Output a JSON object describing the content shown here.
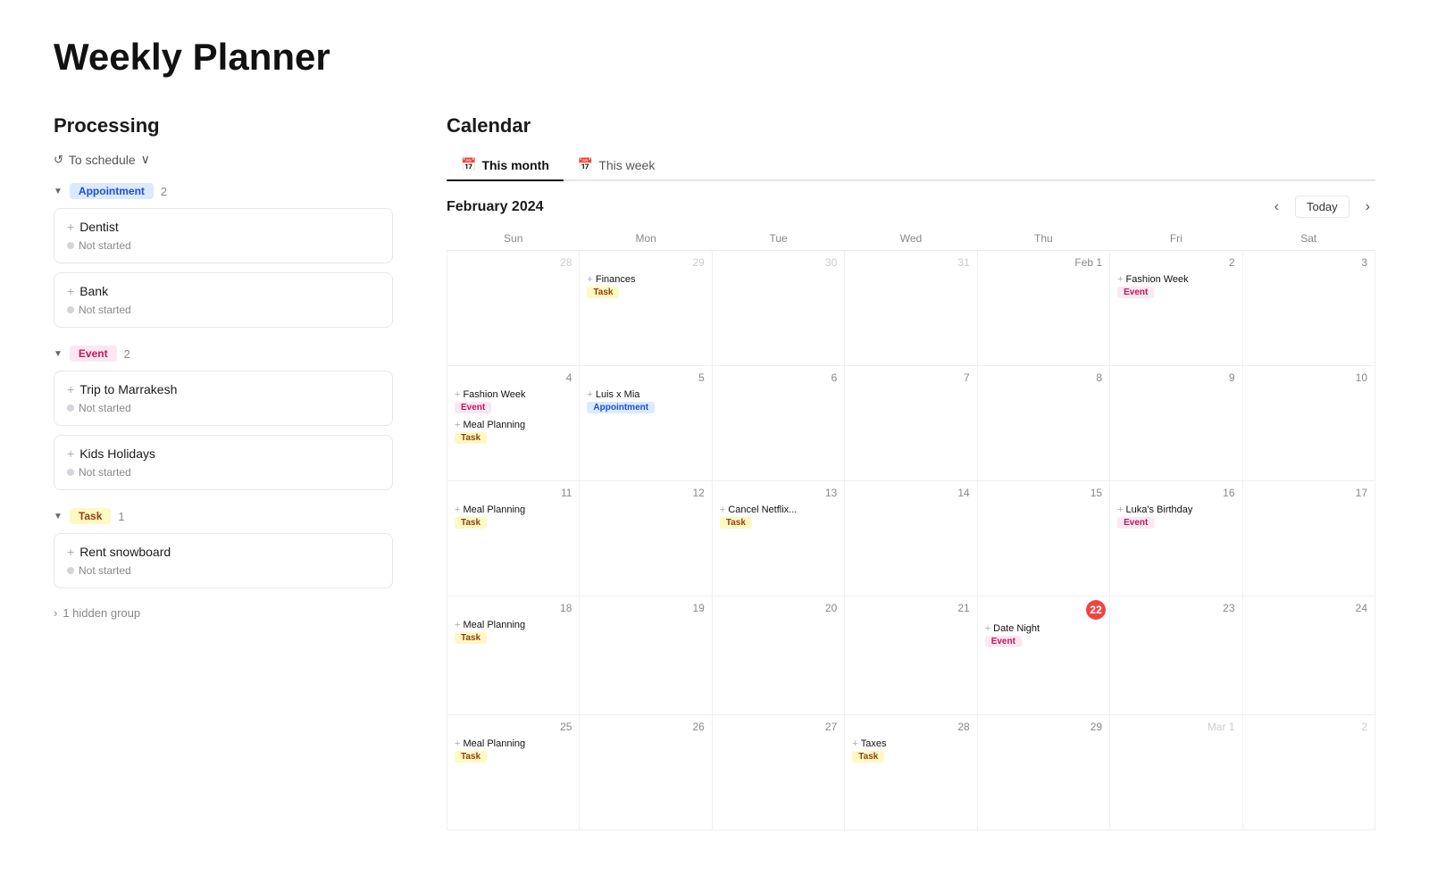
{
  "page": {
    "title": "Weekly Planner"
  },
  "left": {
    "section_title": "Processing",
    "schedule_label": "To schedule",
    "groups": [
      {
        "name": "appointment",
        "label": "Appointment",
        "badge_class": "badge-appointment",
        "count": 2,
        "tasks": [
          {
            "title": "Dentist",
            "status": "Not started"
          },
          {
            "title": "Bank",
            "status": "Not started"
          }
        ]
      },
      {
        "name": "event",
        "label": "Event",
        "badge_class": "badge-event",
        "count": 2,
        "tasks": [
          {
            "title": "Trip to Marrakesh",
            "status": "Not started"
          },
          {
            "title": "Kids Holidays",
            "status": "Not started"
          }
        ]
      },
      {
        "name": "task",
        "label": "Task",
        "badge_class": "badge-task",
        "count": 1,
        "tasks": [
          {
            "title": "Rent snowboard",
            "status": "Not started"
          }
        ]
      }
    ],
    "hidden_group_label": "1 hidden group"
  },
  "calendar": {
    "title": "Calendar",
    "tabs": [
      {
        "label": "This month",
        "active": true
      },
      {
        "label": "This week",
        "active": false
      }
    ],
    "month_label": "February 2024",
    "today_label": "Today",
    "day_headers": [
      "Sun",
      "Mon",
      "Tue",
      "Wed",
      "Thu",
      "Fri",
      "Sat"
    ],
    "weeks": [
      [
        {
          "num": "28",
          "other": true,
          "events": []
        },
        {
          "num": "29",
          "other": true,
          "events": [
            {
              "title": "Finances",
              "badge": "Task",
              "badge_class": "cal-badge-task"
            }
          ]
        },
        {
          "num": "30",
          "other": true,
          "events": []
        },
        {
          "num": "31",
          "other": true,
          "events": []
        },
        {
          "num": "Feb 1",
          "other": false,
          "events": []
        },
        {
          "num": "2",
          "other": false,
          "events": [
            {
              "title": "Fashion Week",
              "badge": "Event",
              "badge_class": "cal-badge-event"
            }
          ]
        },
        {
          "num": "3",
          "other": false,
          "events": []
        }
      ],
      [
        {
          "num": "4",
          "other": false,
          "events": [
            {
              "title": "Fashion Week",
              "badge": "Event",
              "badge_class": "cal-badge-event"
            },
            {
              "title": "Meal Planning",
              "badge": "Task",
              "badge_class": "cal-badge-task"
            }
          ]
        },
        {
          "num": "5",
          "other": false,
          "events": [
            {
              "title": "Luis x Mia",
              "badge": "Appointment",
              "badge_class": "cal-badge-appointment"
            }
          ]
        },
        {
          "num": "6",
          "other": false,
          "events": []
        },
        {
          "num": "7",
          "other": false,
          "events": []
        },
        {
          "num": "8",
          "other": false,
          "events": []
        },
        {
          "num": "9",
          "other": false,
          "events": []
        },
        {
          "num": "10",
          "other": false,
          "events": []
        }
      ],
      [
        {
          "num": "11",
          "other": false,
          "events": [
            {
              "title": "Meal Planning",
              "badge": "Task",
              "badge_class": "cal-badge-task"
            }
          ]
        },
        {
          "num": "12",
          "other": false,
          "events": []
        },
        {
          "num": "13",
          "other": false,
          "events": [
            {
              "title": "Cancel Netflix...",
              "badge": "Task",
              "badge_class": "cal-badge-task"
            }
          ]
        },
        {
          "num": "14",
          "other": false,
          "events": []
        },
        {
          "num": "15",
          "other": false,
          "events": []
        },
        {
          "num": "16",
          "other": false,
          "events": [
            {
              "title": "Luka's Birthday",
              "badge": "Event",
              "badge_class": "cal-badge-event"
            }
          ]
        },
        {
          "num": "17",
          "other": false,
          "events": []
        }
      ],
      [
        {
          "num": "18",
          "other": false,
          "events": [
            {
              "title": "Meal Planning",
              "badge": "Task",
              "badge_class": "cal-badge-task"
            }
          ]
        },
        {
          "num": "19",
          "other": false,
          "events": []
        },
        {
          "num": "20",
          "other": false,
          "events": []
        },
        {
          "num": "21",
          "other": false,
          "events": []
        },
        {
          "num": "22",
          "other": false,
          "today": true,
          "events": [
            {
              "title": "Date Night",
              "badge": "Event",
              "badge_class": "cal-badge-event"
            }
          ]
        },
        {
          "num": "23",
          "other": false,
          "events": []
        },
        {
          "num": "24",
          "other": false,
          "events": []
        }
      ],
      [
        {
          "num": "25",
          "other": false,
          "events": [
            {
              "title": "Meal Planning",
              "badge": "Task",
              "badge_class": "cal-badge-task"
            }
          ]
        },
        {
          "num": "26",
          "other": false,
          "events": []
        },
        {
          "num": "27",
          "other": false,
          "events": []
        },
        {
          "num": "28",
          "other": false,
          "events": [
            {
              "title": "Taxes",
              "badge": "Task",
              "badge_class": "cal-badge-task"
            }
          ]
        },
        {
          "num": "29",
          "other": false,
          "events": []
        },
        {
          "num": "Mar 1",
          "other": true,
          "events": []
        },
        {
          "num": "2",
          "other": true,
          "events": []
        }
      ]
    ]
  }
}
